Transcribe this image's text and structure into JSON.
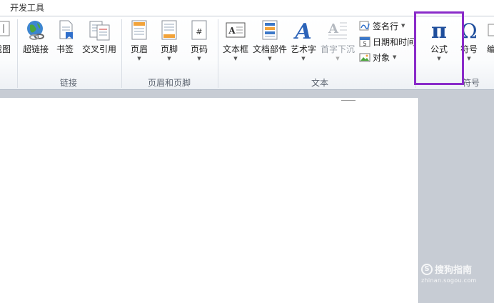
{
  "tabs": {
    "active": "开发工具"
  },
  "ribbon": {
    "groups": {
      "links": "链接",
      "header_footer": "页眉和页脚",
      "text": "文本",
      "symbols": "符号"
    },
    "buttons": {
      "screenshot": "截图",
      "hyperlink": "超链接",
      "bookmark": "书签",
      "cross_reference": "交叉引用",
      "header": "页眉",
      "footer": "页脚",
      "page_number": "页码",
      "textbox": "文本框",
      "quick_parts": "文档部件",
      "wordart": "艺术字",
      "drop_cap": "首字下沉",
      "signature_line": "签名行",
      "date_time": "日期和时间",
      "object": "对象",
      "equation": "公式",
      "symbol": "符号",
      "number": "编"
    },
    "glyphs": {
      "pi": "π",
      "omega": "Ω",
      "wordart_letter": "A",
      "page_number_mark": "#"
    }
  },
  "watermark": {
    "logo_letter": "S",
    "text": "搜狗指南",
    "url": "zhinan.sogou.com"
  },
  "colors": {
    "highlight": "#8a2bc9",
    "accent_blue": "#1f4e9c"
  }
}
